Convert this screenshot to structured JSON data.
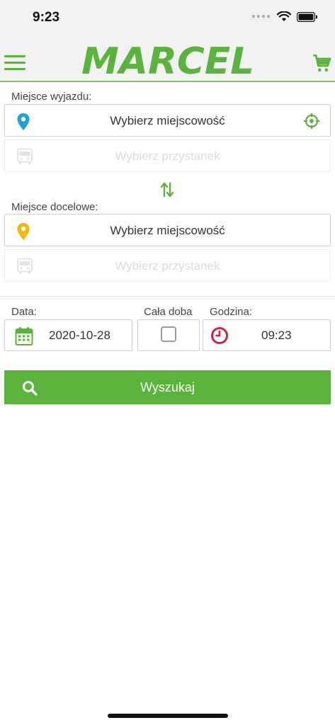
{
  "status_bar": {
    "time": "9:23"
  },
  "header": {
    "logo_text": "MARCEL"
  },
  "departure": {
    "label": "Miejsce wyjazdu:",
    "city_placeholder": "Wybierz miejscowość",
    "stop_placeholder": "Wybierz przystanek"
  },
  "destination": {
    "label": "Miejsce docelowe:",
    "city_placeholder": "Wybierz miejscowość",
    "stop_placeholder": "Wybierz przystanek"
  },
  "date": {
    "label": "Data:",
    "value": "2020-10-28"
  },
  "all_day": {
    "label": "Cała doba",
    "checked": false
  },
  "time": {
    "label": "Godzina:",
    "value": "09:23"
  },
  "search": {
    "label": "Wyszukaj"
  },
  "colors": {
    "accent_green": "#5ab33c",
    "departure_pin": "#1e9fd8",
    "destination_pin": "#f5b800",
    "clock_red": "#d0213c"
  }
}
